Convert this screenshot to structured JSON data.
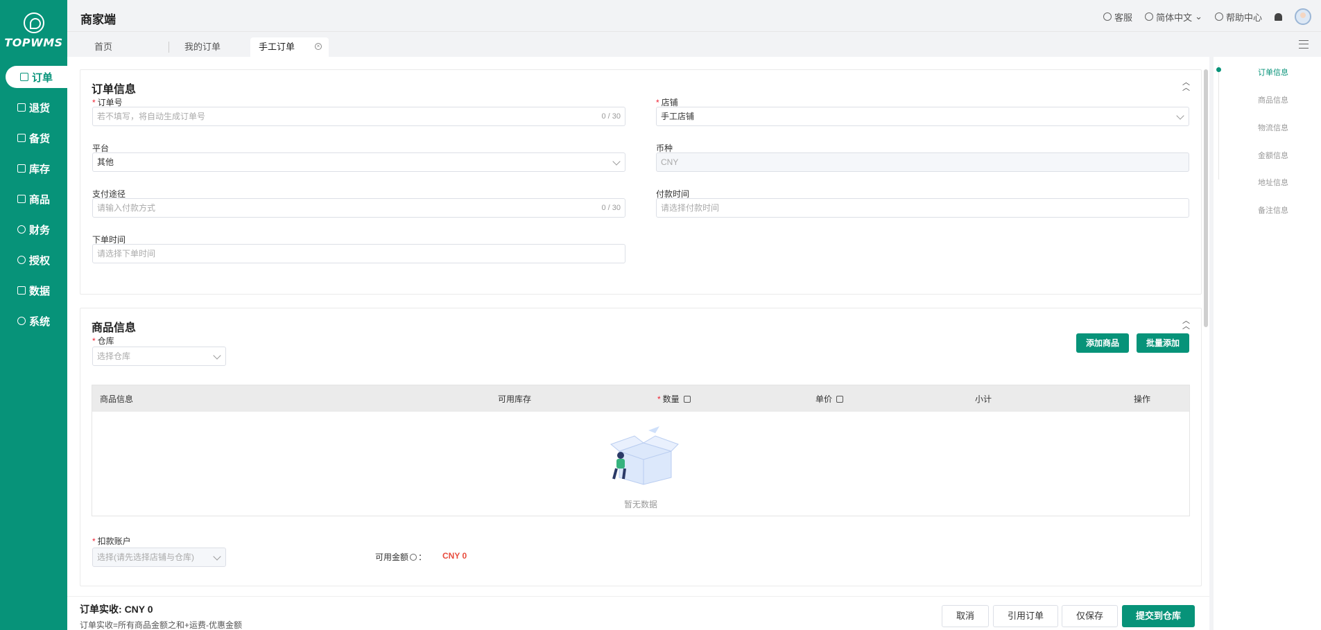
{
  "brand": {
    "logo_text": "TOPWMS",
    "app_title": "商家端"
  },
  "sidebar": {
    "items": [
      {
        "label": "订单",
        "active": true
      },
      {
        "label": "退货"
      },
      {
        "label": "备货"
      },
      {
        "label": "库存"
      },
      {
        "label": "商品"
      },
      {
        "label": "财务"
      },
      {
        "label": "授权"
      },
      {
        "label": "数据"
      },
      {
        "label": "系统"
      }
    ]
  },
  "header": {
    "service": "客服",
    "language": "简体中文",
    "help": "帮助中心"
  },
  "tabs": [
    {
      "label": "首页"
    },
    {
      "label": "我的订单"
    },
    {
      "label": "手工订单",
      "active": true
    }
  ],
  "order_info": {
    "title": "订单信息",
    "order_no": {
      "label": "订单号",
      "placeholder": "若不填写，将自动生成订单号",
      "counter": "0 / 30"
    },
    "shop": {
      "label": "店铺",
      "value": "手工店铺"
    },
    "platform": {
      "label": "平台",
      "value": "其他"
    },
    "currency": {
      "label": "币种",
      "value": "CNY"
    },
    "payment_method": {
      "label": "支付途径",
      "placeholder": "请输入付款方式",
      "counter": "0 / 30"
    },
    "payment_time": {
      "label": "付款时间",
      "placeholder": "请选择付款时间"
    },
    "order_time": {
      "label": "下单时间",
      "placeholder": "请选择下单时间"
    }
  },
  "goods_info": {
    "title": "商品信息",
    "warehouse": {
      "label": "仓库",
      "placeholder": "选择仓库"
    },
    "add_goods": "添加商品",
    "batch_add": "批量添加",
    "columns": [
      "商品信息",
      "可用库存",
      "数量",
      "单价",
      "小计",
      "操作"
    ],
    "empty_text": "暂无数据",
    "account": {
      "label": "扣款账户",
      "placeholder": "选择(请先选择店铺与仓库)"
    },
    "available_label": "可用金额",
    "available_value": "CNY 0"
  },
  "anchors": [
    "订单信息",
    "商品信息",
    "物流信息",
    "金额信息",
    "地址信息",
    "备注信息"
  ],
  "footer": {
    "total_label": "订单实收:",
    "total_value": "CNY 0",
    "formula": "订单实收=所有商品金额之和+运费-优惠金额",
    "cancel": "取消",
    "quote": "引用订单",
    "save": "仅保存",
    "submit": "提交到仓库"
  },
  "colors": {
    "brand": "#079379",
    "danger": "#e84c3d"
  }
}
